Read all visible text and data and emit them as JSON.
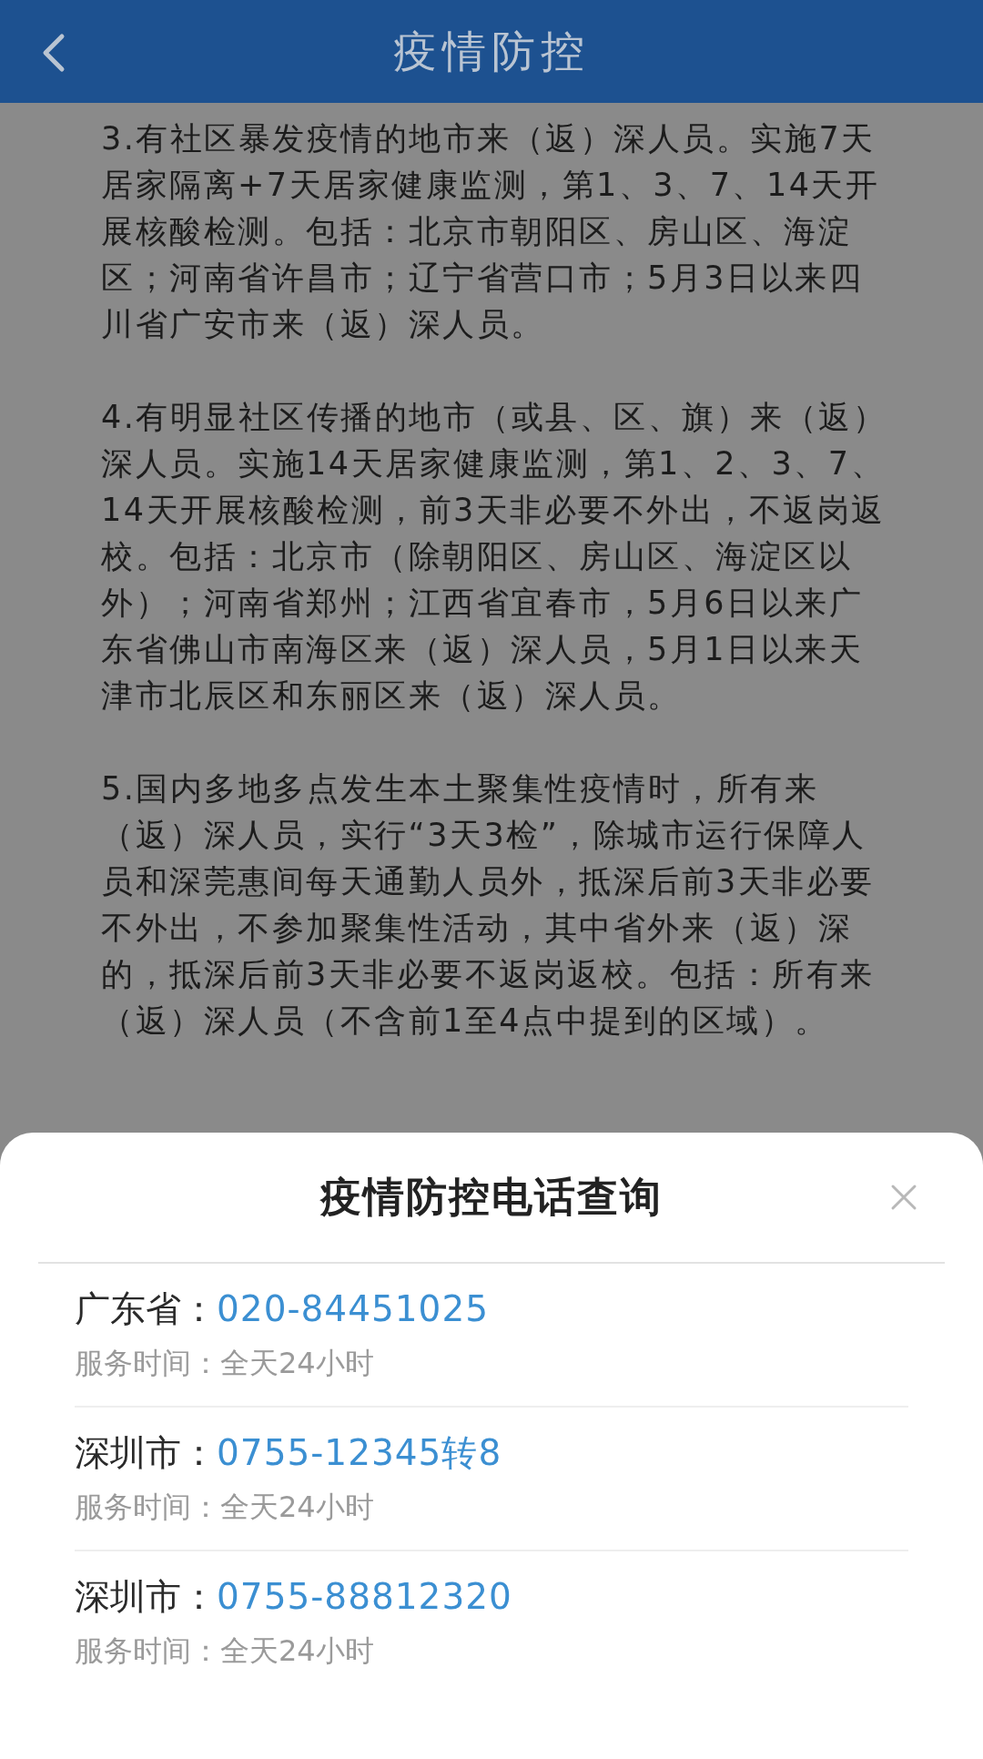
{
  "header": {
    "title": "疫情防控"
  },
  "notices": [
    "3.有社区暴发疫情的地市来（返）深人员。实施7天居家隔离+7天居家健康监测，第1、3、7、14天开展核酸检测。包括：北京市朝阳区、房山区、海淀区；河南省许昌市；辽宁省营口市；5月3日以来四川省广安市来（返）深人员。",
    "4.有明显社区传播的地市（或县、区、旗）来（返）深人员。实施14天居家健康监测，第1、2、3、7、14天开展核酸检测，前3天非必要不外出，不返岗返校。包括：北京市（除朝阳区、房山区、海淀区以外）；河南省郑州；江西省宜春市，5月6日以来广东省佛山市南海区来（返）深人员，5月1日以来天津市北辰区和东丽区来（返）深人员。",
    "5.国内多地多点发生本土聚集性疫情时，所有来（返）深人员，实行“3天3检”，除城市运行保障人员和深莞惠间每天通勤人员外，抵深后前3天非必要不外出，不参加聚集性活动，其中省外来（返）深的，抵深后前3天非必要不返岗返校。包括：所有来（返）深人员（不含前1至4点中提到的区域）。"
  ],
  "sheet": {
    "title": "疫情防控电话查询",
    "contacts": [
      {
        "region": "广东省：",
        "phone": "020-84451025",
        "hours_label": "服务时间：",
        "hours": "全天24小时"
      },
      {
        "region": "深圳市：",
        "phone": "0755-12345转8",
        "hours_label": "服务时间：",
        "hours": "全天24小时"
      },
      {
        "region": "深圳市：",
        "phone": "0755-88812320",
        "hours_label": "服务时间：",
        "hours": "全天24小时"
      }
    ]
  }
}
